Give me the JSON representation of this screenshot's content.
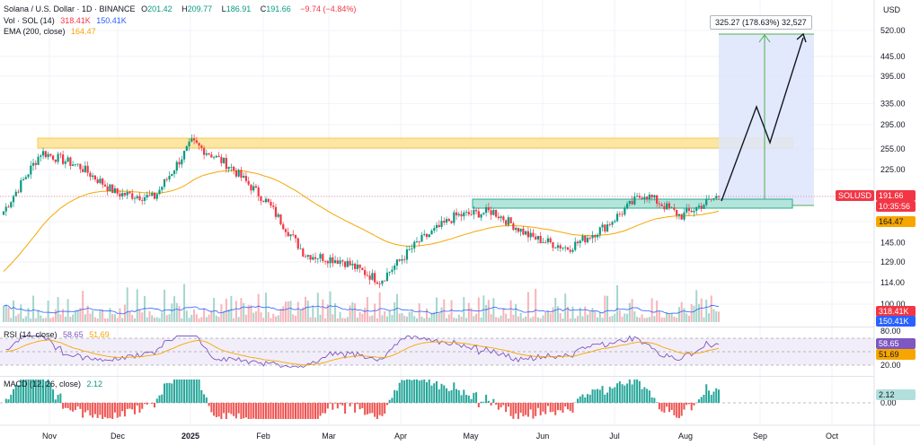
{
  "legend": {
    "symbol": "Solana / U.S. Dollar · 1D · BINANCE",
    "o_label": "O",
    "o": "201.42",
    "h_label": "H",
    "h": "209.77",
    "l_label": "L",
    "l": "186.91",
    "c_label": "C",
    "c": "191.66",
    "change": "−9.74 (−4.84%)",
    "vol_label": "Vol · SOL (14)",
    "vol_1": "318.41K",
    "vol_2": "150.41K",
    "ema_label": "EMA (200, close)",
    "ema_val": "164.47",
    "rsi_label": "RSI (14, close)",
    "rsi_val": "58.65",
    "rsi_val2": "51.69",
    "macd_label": "MACD (12, 26, close)",
    "macd_val": "2.12"
  },
  "currency": "USD",
  "price_axis": [
    "520.00",
    "445.00",
    "395.00",
    "335.00",
    "295.00",
    "255.00",
    "225.00",
    "191.66",
    "164.47",
    "145.00",
    "129.00",
    "114.00",
    "100.00"
  ],
  "price_tags": {
    "symbol": "SOLUSD",
    "last": "191.66",
    "countdown": "10:35:56",
    "ema": "164.47",
    "vol_1": "318.41K",
    "vol_2": "150.41K",
    "rsi_1": "58.65",
    "rsi_2": "51.69",
    "macd": "2.12"
  },
  "rsi_axis": [
    "80.00",
    "20.00"
  ],
  "macd_axis": [
    "0.00"
  ],
  "time_axis": [
    "Nov",
    "Dec",
    "2025",
    "Feb",
    "Mar",
    "Apr",
    "May",
    "Jun",
    "Jul",
    "Aug",
    "Sep",
    "Oct"
  ],
  "measure": {
    "text": "325.27 (178.63%) 32,527"
  },
  "colors": {
    "up": "#089981",
    "down": "#f23645",
    "ema": "#f7a600",
    "volume_ma": "#2962ff",
    "rsi": "#7e57c2",
    "resistance_zone": "#f7c948",
    "support_zone": "#22ab94",
    "measure_fill": "#2962ff",
    "measure_line": "#4caf50"
  },
  "chart_data": {
    "type": "candlestick",
    "symbol": "SOLUSD",
    "interval": "1D",
    "price_scale": "log",
    "last_close": 191.66,
    "ema_200_last": 164.47,
    "resistance_zone": [
      255,
      275
    ],
    "support_zone": [
      183,
      191
    ],
    "projection_target": 520,
    "monthly_path": [
      {
        "month": "Nov",
        "price": 175
      },
      {
        "month": "Nov",
        "price": 250
      },
      {
        "month": "Dec",
        "price": 230
      },
      {
        "month": "Dec",
        "price": 195
      },
      {
        "month": "2025",
        "price": 190
      },
      {
        "month": "2025",
        "price": 265
      },
      {
        "month": "Feb",
        "price": 230
      },
      {
        "month": "Feb",
        "price": 185
      },
      {
        "month": "Mar",
        "price": 135
      },
      {
        "month": "Mar",
        "price": 130
      },
      {
        "month": "Apr",
        "price": 115
      },
      {
        "month": "Apr",
        "price": 145
      },
      {
        "month": "May",
        "price": 170
      },
      {
        "month": "May",
        "price": 175
      },
      {
        "month": "Jun",
        "price": 150
      },
      {
        "month": "Jun",
        "price": 140
      },
      {
        "month": "Jul",
        "price": 160
      },
      {
        "month": "Jul",
        "price": 195
      },
      {
        "month": "Aug",
        "price": 170
      },
      {
        "month": "Aug",
        "price": 192
      }
    ]
  }
}
